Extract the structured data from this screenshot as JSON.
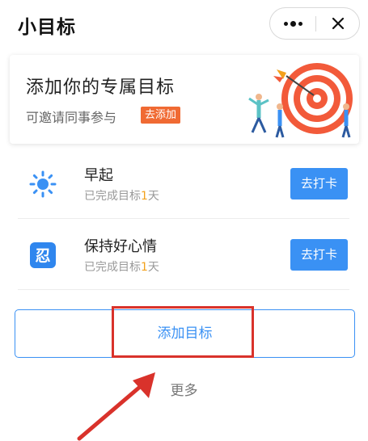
{
  "header": {
    "title": "小目标",
    "more_icon": "more-dots-icon",
    "close_icon": "close-icon"
  },
  "banner": {
    "title": "添加你的专属目标",
    "subtitle": "可邀请同事参与",
    "button_label": "去添加",
    "illustration": "archery-target-illustration"
  },
  "goals": [
    {
      "name": "早起",
      "icon": "sun-icon",
      "progress_prefix": "已完成目标",
      "progress_days": "1",
      "progress_suffix": "天",
      "button_label": "去打卡"
    },
    {
      "name": "保持好心情",
      "icon": "patience-ren-icon",
      "icon_text": "忍",
      "progress_prefix": "已完成目标",
      "progress_days": "1",
      "progress_suffix": "天",
      "button_label": "去打卡"
    }
  ],
  "actions": {
    "add_goal_label": "添加目标",
    "more_label": "更多"
  },
  "colors": {
    "primary": "#3a91f4",
    "accent_orange": "#f06a33",
    "progress_day": "#f3a11c",
    "annotation_red": "#d9322b"
  }
}
